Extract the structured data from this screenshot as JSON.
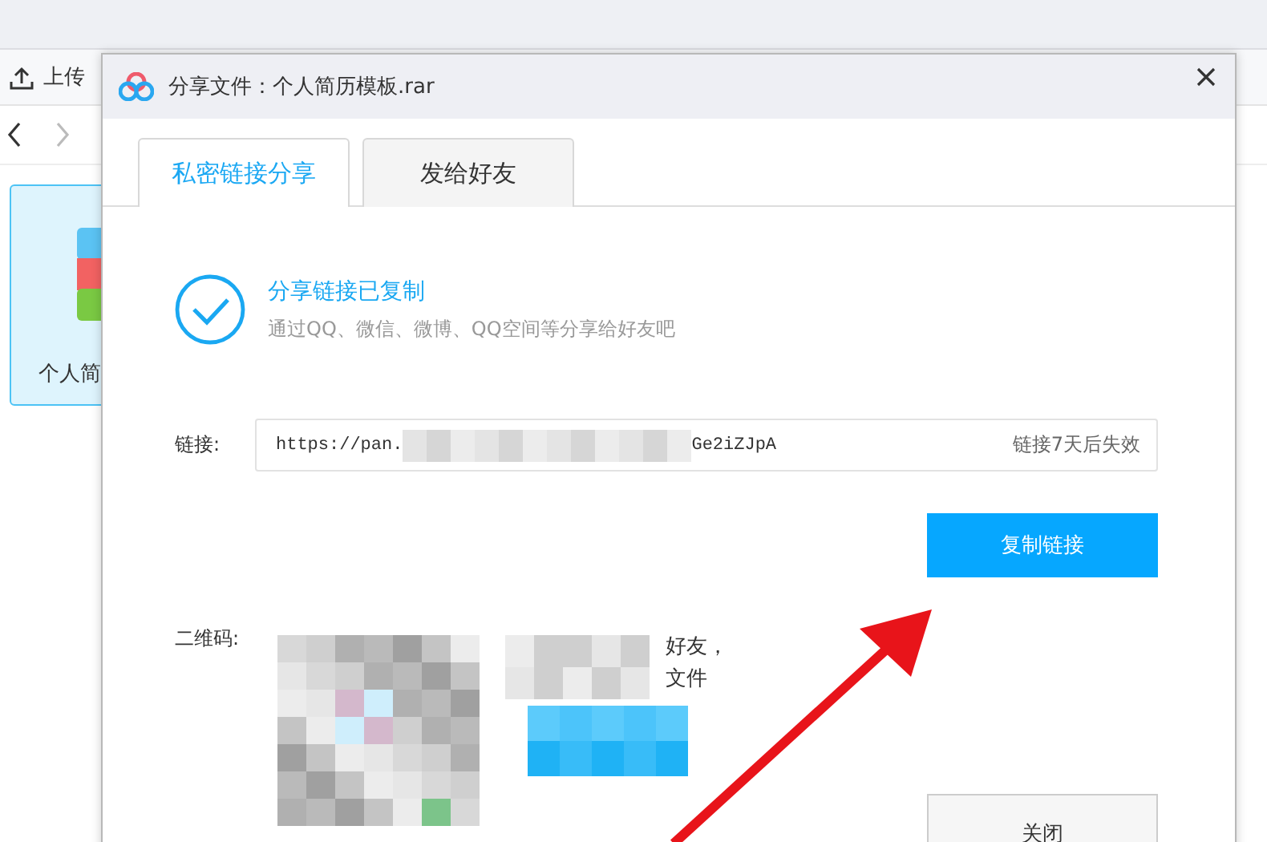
{
  "app": {
    "upload_label": "上传",
    "file_tile": {
      "name": "个人简",
      "selected": true
    }
  },
  "dialog": {
    "title": "分享文件：个人简历模板.rar",
    "tabs": [
      {
        "label": "私密链接分享",
        "selected": true
      },
      {
        "label": "发给好友",
        "selected": false
      }
    ],
    "status": {
      "title": "分享链接已复制",
      "subtitle": "通过QQ、微信、微博、QQ空间等分享给好友吧"
    },
    "link": {
      "label": "链接:",
      "value_start": "https://pan.",
      "value_end": "Ge2iZJpA",
      "expiry": "链接7天后失效"
    },
    "copy_button": "复制链接",
    "qr": {
      "label": "二维码:",
      "hint_fragments": [
        "好友，",
        "文件"
      ]
    },
    "close_button": "关闭"
  }
}
